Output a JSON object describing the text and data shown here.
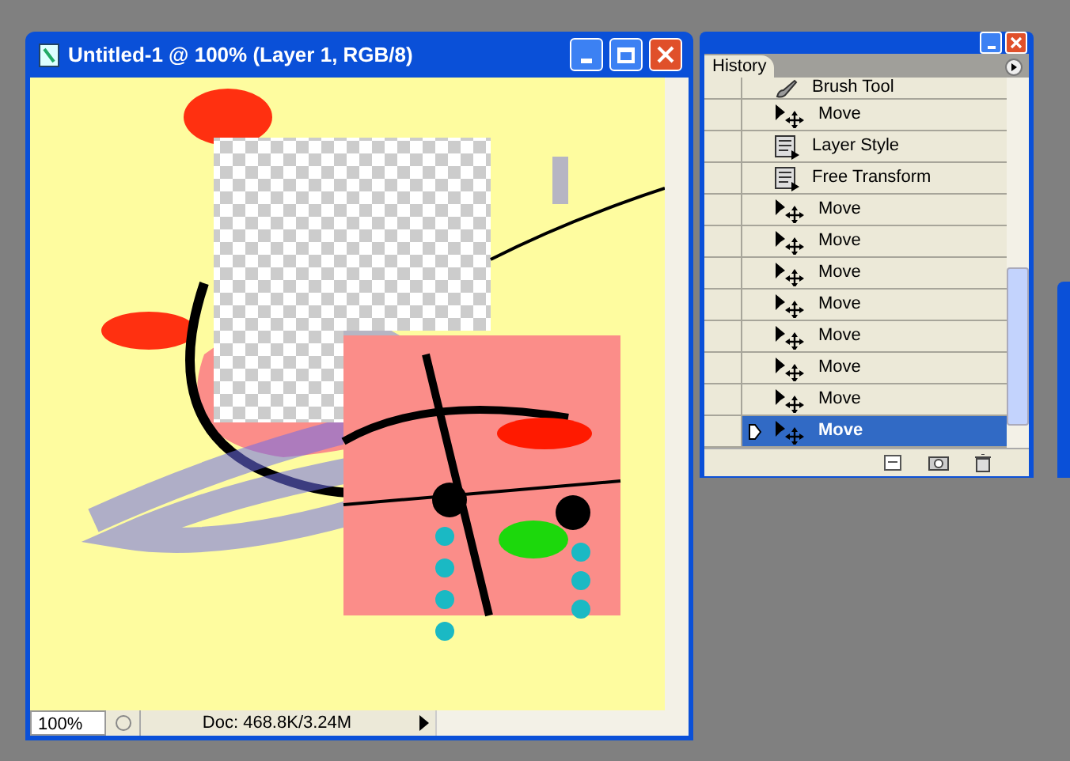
{
  "document_window": {
    "title": "Untitled-1 @ 100% (Layer 1, RGB/8)",
    "zoom": "100%",
    "doc_info": "Doc: 468.8K/3.24M"
  },
  "history_panel": {
    "tab": "History",
    "items": [
      {
        "kind": "brush",
        "label": "Brush Tool",
        "selected": false,
        "source": false
      },
      {
        "kind": "move",
        "label": "Move",
        "selected": false,
        "source": false
      },
      {
        "kind": "action",
        "label": "Layer Style",
        "selected": false,
        "source": false
      },
      {
        "kind": "action",
        "label": "Free Transform",
        "selected": false,
        "source": false
      },
      {
        "kind": "move",
        "label": "Move",
        "selected": false,
        "source": false
      },
      {
        "kind": "move",
        "label": "Move",
        "selected": false,
        "source": false
      },
      {
        "kind": "move",
        "label": "Move",
        "selected": false,
        "source": false
      },
      {
        "kind": "move",
        "label": "Move",
        "selected": false,
        "source": false
      },
      {
        "kind": "move",
        "label": "Move",
        "selected": false,
        "source": false
      },
      {
        "kind": "move",
        "label": "Move",
        "selected": false,
        "source": false
      },
      {
        "kind": "move",
        "label": "Move",
        "selected": false,
        "source": false
      },
      {
        "kind": "move",
        "label": "Move",
        "selected": true,
        "source": false
      }
    ]
  }
}
